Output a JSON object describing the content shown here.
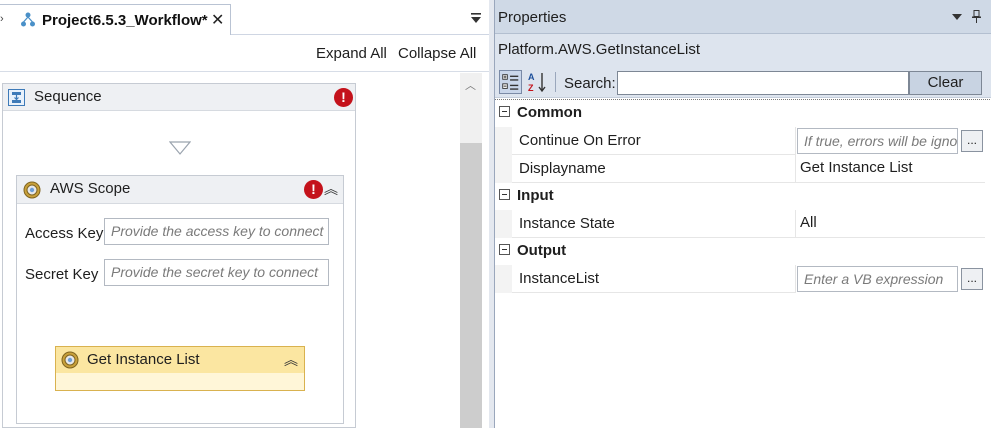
{
  "designer": {
    "tab_title": "Project6.5.3_Workflow*",
    "tab_close": "✕",
    "expand_all": "Expand All",
    "collapse_all": "Collapse All",
    "sequence": {
      "label": "Sequence",
      "error_mark": "!"
    },
    "aws_scope": {
      "label": "AWS Scope",
      "error_mark": "!",
      "fields": [
        {
          "label": "Access Key",
          "placeholder": "Provide the access key to connect"
        },
        {
          "label": "Secret Key",
          "placeholder": "Provide the secret key to connect"
        }
      ]
    },
    "get_instance_list": {
      "label": "Get Instance List"
    }
  },
  "properties": {
    "title": "Properties",
    "subtitle": "Platform.AWS.GetInstanceList",
    "search_label": "Search:",
    "search_value": "",
    "clear_label": "Clear",
    "categories": [
      {
        "name": "Common",
        "rows": [
          {
            "name": "Continue On Error",
            "placeholder": "If true, errors will be ignored",
            "ellipsis": "..."
          },
          {
            "name": "Displayname",
            "value": "Get Instance List"
          }
        ]
      },
      {
        "name": "Input",
        "rows": [
          {
            "name": "Instance State",
            "value": "All"
          }
        ]
      },
      {
        "name": "Output",
        "rows": [
          {
            "name": "InstanceList",
            "placeholder": "Enter a VB expression",
            "ellipsis": "..."
          }
        ]
      }
    ]
  },
  "icons": {
    "workflow_tab": "workflow-icon",
    "sequence": "sequence-icon",
    "aws_scope": "gear-icon",
    "get_instance_list": "gear-icon",
    "error": "error-icon",
    "collapse": "double-chevron-up-icon"
  },
  "colors": {
    "error": "#c4121b",
    "activity_highlight": "#fbe6a1",
    "panel_header": "#cfd9e6"
  }
}
